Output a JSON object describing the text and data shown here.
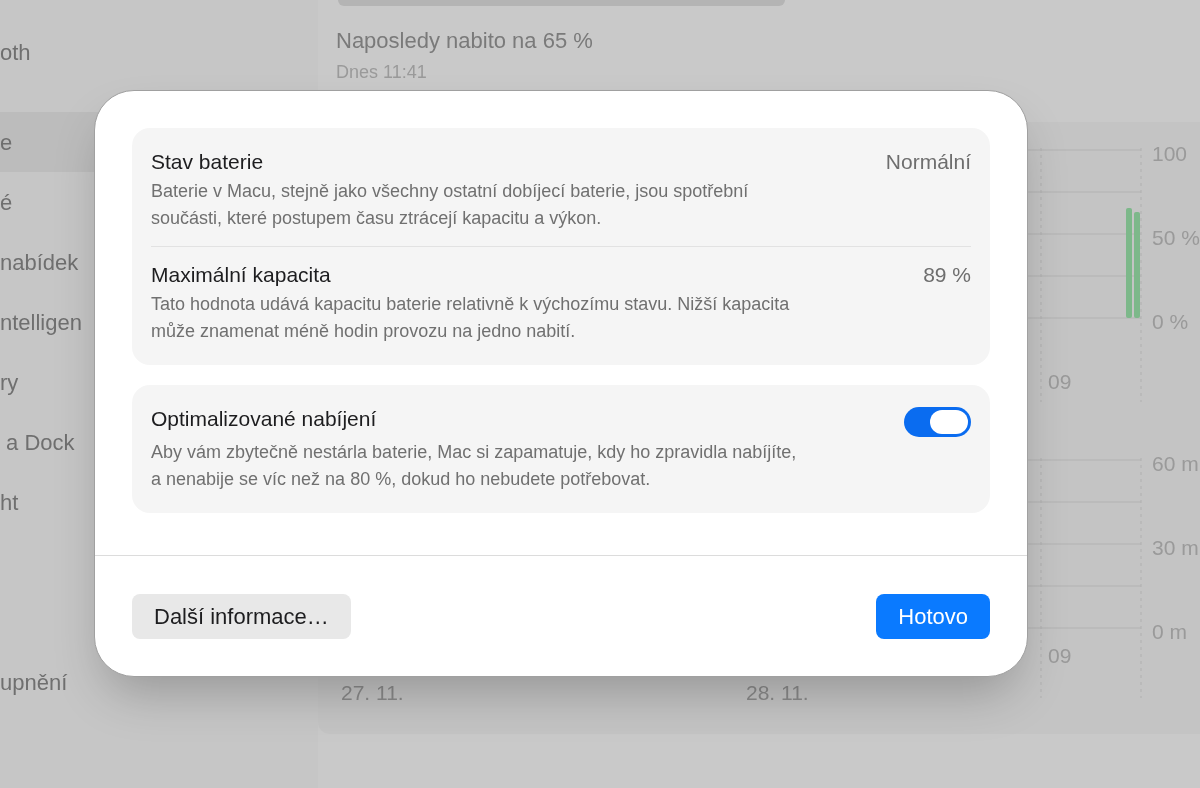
{
  "sidebar": {
    "items": [
      {
        "label": "oth",
        "selected": false
      },
      {
        "label": "e",
        "selected": true
      },
      {
        "label": "é",
        "selected": false
      },
      {
        "label": "nabídek",
        "selected": false
      },
      {
        "label": "ntelligen",
        "selected": false
      },
      {
        "label": "ry",
        "selected": false
      },
      {
        "label": " a Dock",
        "selected": false
      },
      {
        "label": "ht",
        "selected": false
      },
      {
        "label": "upnění",
        "selected": false
      }
    ]
  },
  "main": {
    "title": "Naposledy nabito na 65 %",
    "subtitle": "Dnes 11:41",
    "level_chart": {
      "axis_labels": [
        "100",
        "50 %",
        "0 %"
      ],
      "time_label": "09"
    },
    "usage_chart": {
      "axis_labels": [
        "60 m",
        "30 m",
        "0 m"
      ],
      "time_label": "09"
    },
    "dates": [
      "27. 11.",
      "28. 11."
    ]
  },
  "dialog": {
    "sections": [
      {
        "rows": [
          {
            "kind": "value",
            "title": "Stav baterie",
            "value": "Normální",
            "description": "Baterie v Macu, stejně jako všechny ostatní dobíjecí baterie, jsou spotřební součásti, které postupem času ztrácejí kapacitu a výkon."
          },
          {
            "kind": "value",
            "title": "Maximální kapacita",
            "value": "89 %",
            "description": "Tato hodnota udává kapacitu baterie relativně k výchozímu stavu. Nižší kapacita může znamenat méně hodin provozu na jedno nabití."
          }
        ]
      },
      {
        "rows": [
          {
            "kind": "toggle",
            "title": "Optimalizované nabíjení",
            "on": true,
            "description": "Aby vám zbytečně nestárla baterie, Mac si zapamatuje, kdy ho zpravidla nabíjíte, a nenabije se víc než na 80 %, dokud ho nebudete potřebovat."
          }
        ]
      }
    ],
    "buttons": [
      {
        "label": "Další informace…",
        "kind": "secondary"
      },
      {
        "label": "Hotovo",
        "kind": "primary"
      }
    ]
  }
}
